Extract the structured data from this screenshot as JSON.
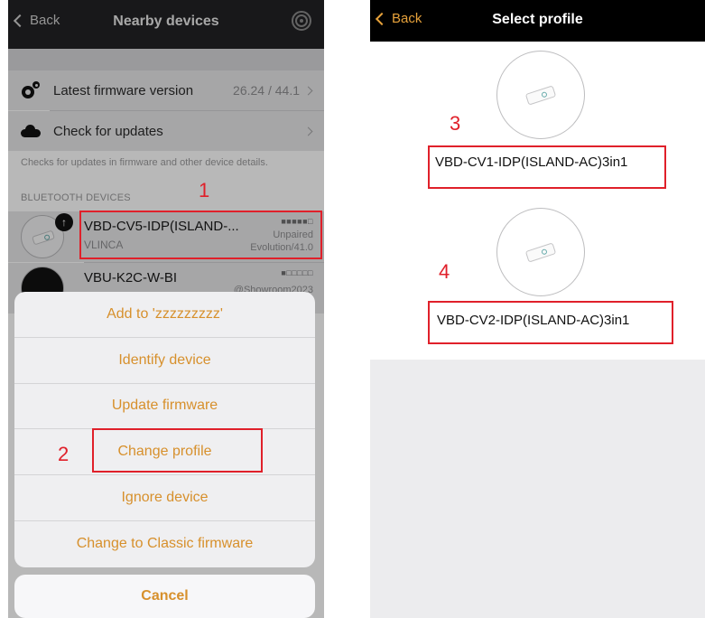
{
  "left": {
    "nav": {
      "back_label": "Back",
      "title": "Nearby devices"
    },
    "rows": [
      {
        "icon": "gears-icon",
        "label": "Latest firmware version",
        "value": "26.24 / 44.1"
      },
      {
        "icon": "cloud-icon",
        "label": "Check for updates",
        "value": ""
      }
    ],
    "footnote": "Checks for updates in firmware and other device details.",
    "section_header": "BLUETOOTH DEVICES",
    "devices": [
      {
        "name": "VBD-CV5-IDP(ISLAND-...",
        "vendor": "VLINCA",
        "signal": "■■■■■□",
        "status": "Unpaired",
        "firmware": "Evolution/41.0"
      },
      {
        "name": "VBU-K2C-W-BI",
        "vendor": "",
        "signal": "■□□□□□",
        "status": "",
        "firmware": "@Showroom2023"
      }
    ],
    "sheet": {
      "items": [
        "Add to 'zzzzzzzzz'",
        "Identify device",
        "Update firmware",
        "Change profile",
        "Ignore device",
        "Change to Classic firmware"
      ],
      "cancel": "Cancel"
    },
    "markers": {
      "one": "1",
      "two": "2"
    }
  },
  "right": {
    "nav": {
      "back_label": "Back",
      "title": "Select profile"
    },
    "profiles": [
      {
        "name": "VBD-CV1-IDP(ISLAND-AC)3in1"
      },
      {
        "name": "VBD-CV2-IDP(ISLAND-AC)3in1"
      }
    ],
    "markers": {
      "three": "3",
      "four": "4"
    }
  },
  "colors": {
    "accent": "#d7902c",
    "back_accent": "#e7a23b",
    "marker_red": "#e0202a"
  }
}
